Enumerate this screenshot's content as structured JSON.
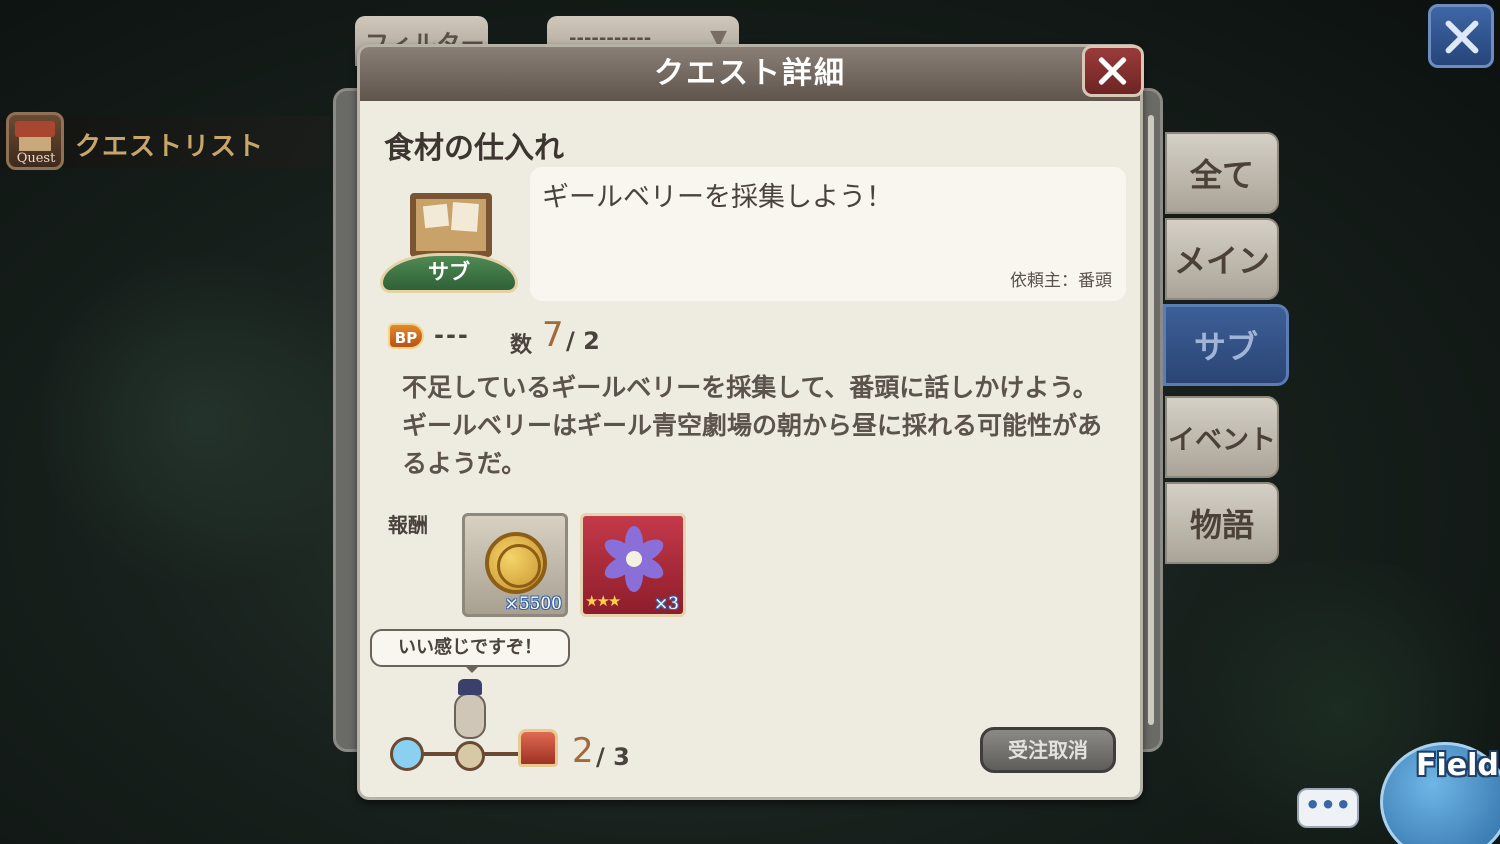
{
  "background": {
    "filter_label": "フィルター",
    "select_value": "-----------"
  },
  "quest_list": {
    "icon_label": "Quest",
    "title": "クエストリスト"
  },
  "tabs": [
    {
      "label": "全て",
      "active": false
    },
    {
      "label": "メイン",
      "active": false
    },
    {
      "label": "サブ",
      "active": true
    },
    {
      "label": "イベント",
      "active": false
    },
    {
      "label": "物語",
      "active": false
    }
  ],
  "dialog": {
    "title": "クエスト詳細",
    "quest_name": "食材の仕入れ",
    "emblem_label": "サブ",
    "objective": "ギールベリーを採集しよう！",
    "client": "依頼主：番頭",
    "bp_label": "BP",
    "bp_value": "---",
    "count_label": "数",
    "count_current": "7",
    "count_required": "/ 2",
    "description": "不足しているギールベリーを採集して、番頭に話しかけよう。ギールベリーはギール青空劇場の朝から昼に採れる可能性があるようだ。",
    "reward_label": "報酬",
    "rewards": [
      {
        "icon": "gold-coin-icon",
        "quantity": "×5500"
      },
      {
        "icon": "purple-flower-icon",
        "stars": "★★★",
        "quantity": "×3"
      }
    ],
    "speech": "いい感じですぞ！",
    "progress_current": "2",
    "progress_total": "/ 3",
    "cancel_label": "受注取消"
  },
  "bottom_right": {
    "chat_label": "•••",
    "field_label": "Field"
  },
  "colors": {
    "accent_gold": "#c9a56a",
    "active_tab": "#2b4475",
    "close_red": "#6e2424"
  }
}
